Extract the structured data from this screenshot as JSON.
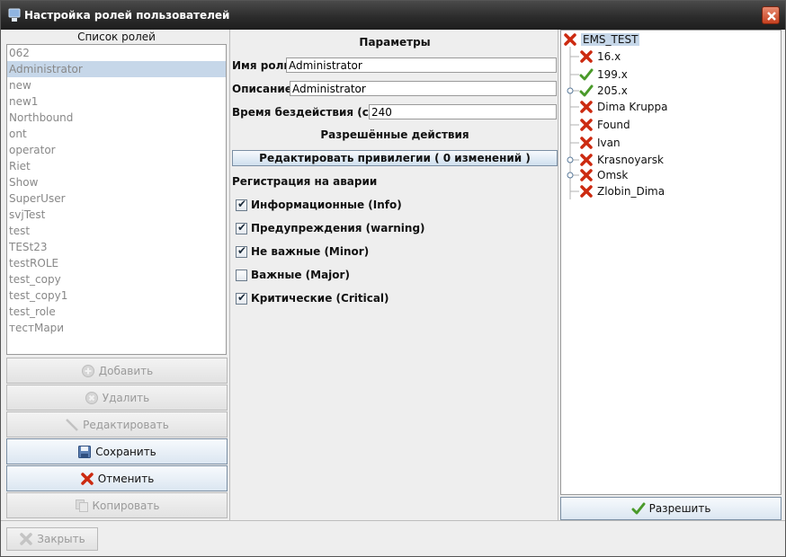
{
  "window": {
    "title": "Настройка ролей пользователей"
  },
  "roles": {
    "caption": "Список ролей",
    "items": [
      "062",
      "Administrator",
      "new",
      "new1",
      "Northbound",
      "ont",
      "operator",
      "Riet",
      "Show",
      "SuperUser",
      "svjTest",
      "test",
      "TESt23",
      "testROLE",
      "test_copy",
      "test_copy1",
      "test_role",
      "тестМари"
    ],
    "selected": "Administrator"
  },
  "left_buttons": {
    "add": "Добавить",
    "delete": "Удалить",
    "edit": "Редактировать",
    "save": "Сохранить",
    "cancel": "Отменить",
    "copy": "Копировать"
  },
  "params": {
    "title": "Параметры",
    "role_name_label": "Имя роли:",
    "role_name_value": "Administrator",
    "description_label": "Описание:",
    "description_value": "Administrator",
    "idle_label": "Время бездействия (сек):",
    "idle_value": "240",
    "permissions_title": "Разрешённые действия",
    "edit_privileges": "Редактировать привилегии ( 0 изменений )",
    "alarm_title": "Регистрация на аварии",
    "alarms": [
      {
        "label": "Информационные (Info)",
        "checked": true
      },
      {
        "label": "Предупреждения (warning)",
        "checked": true
      },
      {
        "label": "Не важные (Minor)",
        "checked": true
      },
      {
        "label": "Важные (Major)",
        "checked": false
      },
      {
        "label": "Критические (Critical)",
        "checked": true
      }
    ]
  },
  "tree": {
    "root": "EMS_TEST",
    "children": [
      {
        "label": "16.x",
        "status": "denied"
      },
      {
        "label": "199.x",
        "status": "allowed"
      },
      {
        "label": "205.x",
        "status": "allowed"
      },
      {
        "label": "Dima Kruppa",
        "status": "denied"
      },
      {
        "label": "Found",
        "status": "denied"
      },
      {
        "label": "Ivan",
        "status": "denied"
      },
      {
        "label": "Krasnoyarsk",
        "status": "denied"
      },
      {
        "label": "Omsk",
        "status": "denied"
      },
      {
        "label": "Zlobin_Dima",
        "status": "denied"
      }
    ],
    "allow_button": "Разрешить"
  },
  "footer": {
    "close": "Закрыть"
  },
  "icons": {
    "allowed": "check-icon",
    "denied": "red-x-icon",
    "colors": {
      "allowed": "#4a9a2a",
      "denied": "#cc2a10",
      "selection": "#c6d7e9"
    }
  }
}
